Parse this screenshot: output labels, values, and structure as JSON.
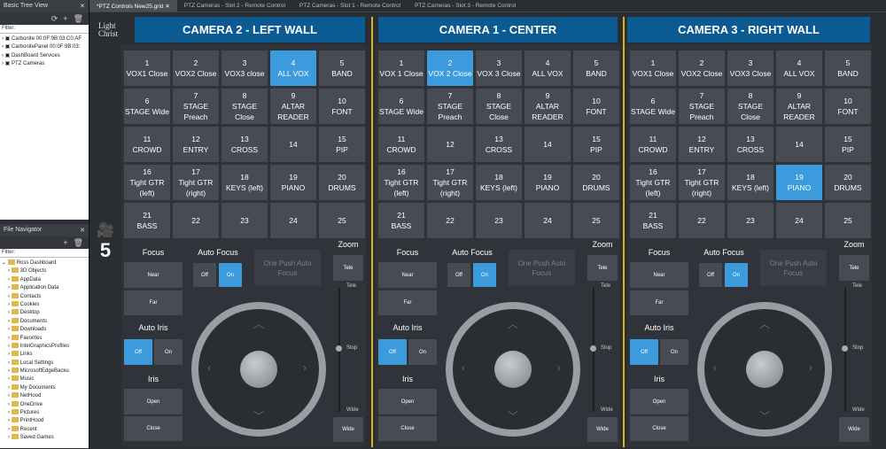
{
  "tree_view": {
    "title": "Basic Tree View",
    "filter_label": "Filter:",
    "items": [
      "Carbonite 00:0F:9B:03:C0:AF",
      "CarbonitePanel 00:0F:9B:03:",
      "DashBoard Services",
      "PTZ Cameras"
    ]
  },
  "file_nav": {
    "title": "File Navigator",
    "filter_label": "Filter:",
    "root": "Ross Dashboard",
    "items": [
      "3D Objects",
      "AppData",
      "Application Data",
      "Contacts",
      "Cookies",
      "Desktop",
      "Documents",
      "Downloads",
      "Favorites",
      "IntelGraphicsProfiles",
      "Links",
      "Local Settings",
      "MicrosoftEdgeBacku",
      "Music",
      "My Documents",
      "NetHood",
      "OneDrive",
      "Pictures",
      "PrintHood",
      "Recent",
      "Saved Games"
    ]
  },
  "tabs": [
    "*PTZ Controls New25.grid",
    "PTZ Cameras - Slot 2 - Remote Control",
    "PTZ Cameras - Slot 1 - Remote Control",
    "PTZ Cameras - Slot 3 - Remote Control"
  ],
  "logo": {
    "line1": "Light",
    "line2": "Christ"
  },
  "camera_number": "5",
  "labels": {
    "focus": "Focus",
    "near": "Near",
    "far": "Far",
    "auto_focus": "Auto Focus",
    "off": "Off",
    "on": "On",
    "one_push": "One Push Auto Focus",
    "zoom": "Zoom",
    "tele": "Tele",
    "wide": "Wide",
    "stop": "Stop",
    "auto_iris": "Auto Iris",
    "iris": "Iris",
    "open": "Open",
    "close": "Close"
  },
  "cameras": [
    {
      "title": "CAMERA 2 - LEFT WALL",
      "active_preset": 4,
      "auto_focus": "on",
      "auto_iris": "off",
      "presets": [
        "1|VOX1 Close",
        "2|VOX2 Close",
        "3|VOX3 close",
        "4|ALL VOX",
        "5|BAND",
        "6|STAGE Wide",
        "7|STAGE Preach",
        "8|STAGE Close",
        "9|ALTAR READER",
        "10|FONT",
        "11|CROWD",
        "12|ENTRY",
        "13|CROSS",
        "14",
        "15|PIP",
        "16|Tight GTR (left)",
        "17|Tight GTR (right)",
        "18|KEYS (left)",
        "19|PIANO",
        "20|DRUMS",
        "21|BASS",
        "22",
        "23",
        "24",
        "25"
      ]
    },
    {
      "title": "CAMERA 1 - CENTER",
      "active_preset": 2,
      "auto_focus": "on",
      "auto_iris": "off",
      "presets": [
        "1|VOX 1 Close",
        "2|VOX 2 Close",
        "3|VOX 3 Close",
        "4|ALL VOX",
        "5|BAND",
        "6|STAGE Wide",
        "7|STAGE Preach",
        "8|STAGE Close",
        "9|ALTAR READER",
        "10|FONT",
        "11|CROWD",
        "12",
        "13|CROSS",
        "14",
        "15|PIP",
        "16|Tight GTR (left)",
        "17|Tight GTR (right)",
        "18|KEYS (left)",
        "19|PIANO",
        "20|DRUMS",
        "21|BASS",
        "22",
        "23",
        "24",
        "25"
      ]
    },
    {
      "title": "CAMERA 3 - RIGHT WALL",
      "active_preset": 19,
      "auto_focus": "on",
      "auto_iris": "off",
      "presets": [
        "1|VOX1 Close",
        "2|VOX2 Close",
        "3|VOX3 Close",
        "4|ALL VOX",
        "5|BAND",
        "6|STAGE Wide",
        "7|STAGE Preach",
        "8|STAGE Close",
        "9|ALTAR READER",
        "10|FONT",
        "11|CROWD",
        "12|ENTRY",
        "13|CROSS",
        "14",
        "15|PIP",
        "16|Tight GTR (left)",
        "17|Tight GTR (right)",
        "18|KEYS (left)",
        "19|PIANO",
        "20|DRUMS",
        "21|BASS",
        "22",
        "23",
        "24",
        "25"
      ]
    }
  ],
  "colors": {
    "accent": "#3b9bdc",
    "header": "#0b5a92",
    "divider": "#d9b61e"
  }
}
